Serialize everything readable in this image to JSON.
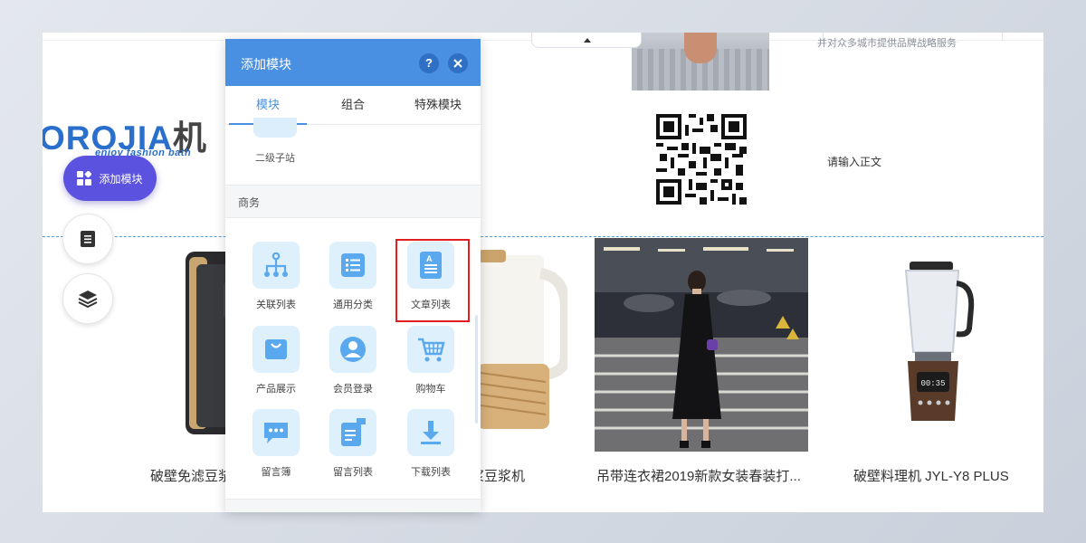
{
  "page": {
    "top_text": "并对众多城市提供品牌战略服务",
    "body_placeholder": "请输入正文",
    "logo_text": "OROJIA",
    "logo_cn": "机",
    "slogan": "enjoy fashion bath"
  },
  "products": [
    {
      "caption": "破壁免滤豆浆"
    },
    {
      "caption": "浆豆浆机"
    },
    {
      "caption": "吊带连衣裙2019新款女装春装打..."
    },
    {
      "caption": "破壁料理机 JYL-Y8 PLUS"
    }
  ],
  "toolbar": {
    "add_module_label": "添加模块"
  },
  "panel": {
    "title": "添加模块",
    "help_label": "?",
    "tabs": [
      {
        "label": "模块"
      },
      {
        "label": "组合"
      },
      {
        "label": "特殊模块"
      }
    ],
    "sub_site_label": "二级子站",
    "section_label": "商务",
    "modules": [
      {
        "label": "关联列表",
        "icon": "hierarchy-icon"
      },
      {
        "label": "通用分类",
        "icon": "list-icon"
      },
      {
        "label": "文章列表",
        "icon": "article-icon"
      },
      {
        "label": "产品展示",
        "icon": "bag-icon"
      },
      {
        "label": "会员登录",
        "icon": "user-icon"
      },
      {
        "label": "购物车",
        "icon": "cart-icon"
      },
      {
        "label": "留言簿",
        "icon": "chat-icon"
      },
      {
        "label": "留言列表",
        "icon": "message-list-icon"
      },
      {
        "label": "下载列表",
        "icon": "download-icon"
      }
    ]
  },
  "colors": {
    "accent": "#4a90e2",
    "add_button": "#5b53e0",
    "highlight": "#e02020",
    "icon_tile": "#dff0fd",
    "icon_fg": "#5aa8ee"
  }
}
